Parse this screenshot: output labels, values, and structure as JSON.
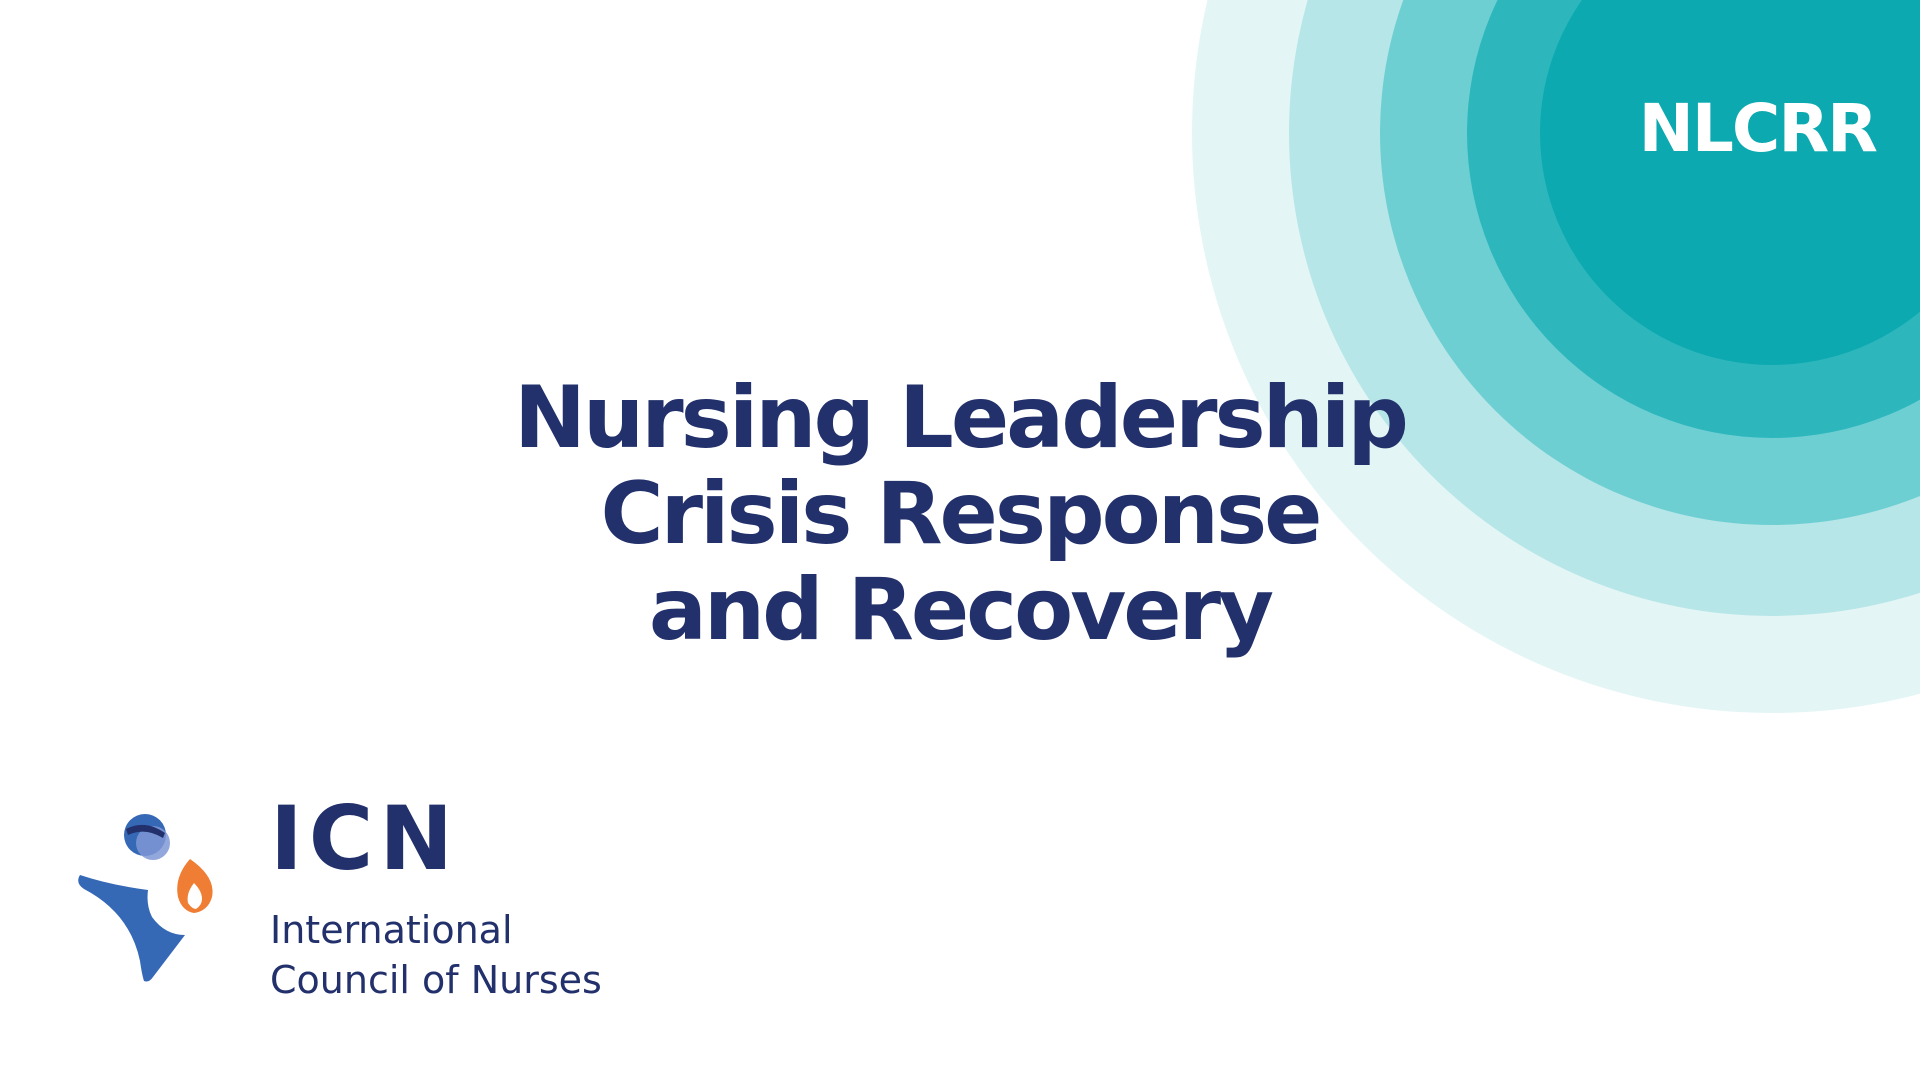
{
  "badge": {
    "text": "NLCRR"
  },
  "title": {
    "lines": [
      "Nursing Leadership",
      "Crisis Response",
      "and Recovery"
    ]
  },
  "organization": {
    "acronym": "ICN",
    "name_lines": [
      "International",
      "Council of Nurses"
    ]
  },
  "colors": {
    "navy": "#22306b",
    "ring_1": "#e3f5f5",
    "ring_2": "#b7e6e8",
    "ring_3": "#6ecfd3",
    "ring_4": "#2db7bd",
    "ring_5": "#0ca9b0",
    "logo_blue": "#3568b5",
    "logo_orange": "#ef7d33"
  }
}
